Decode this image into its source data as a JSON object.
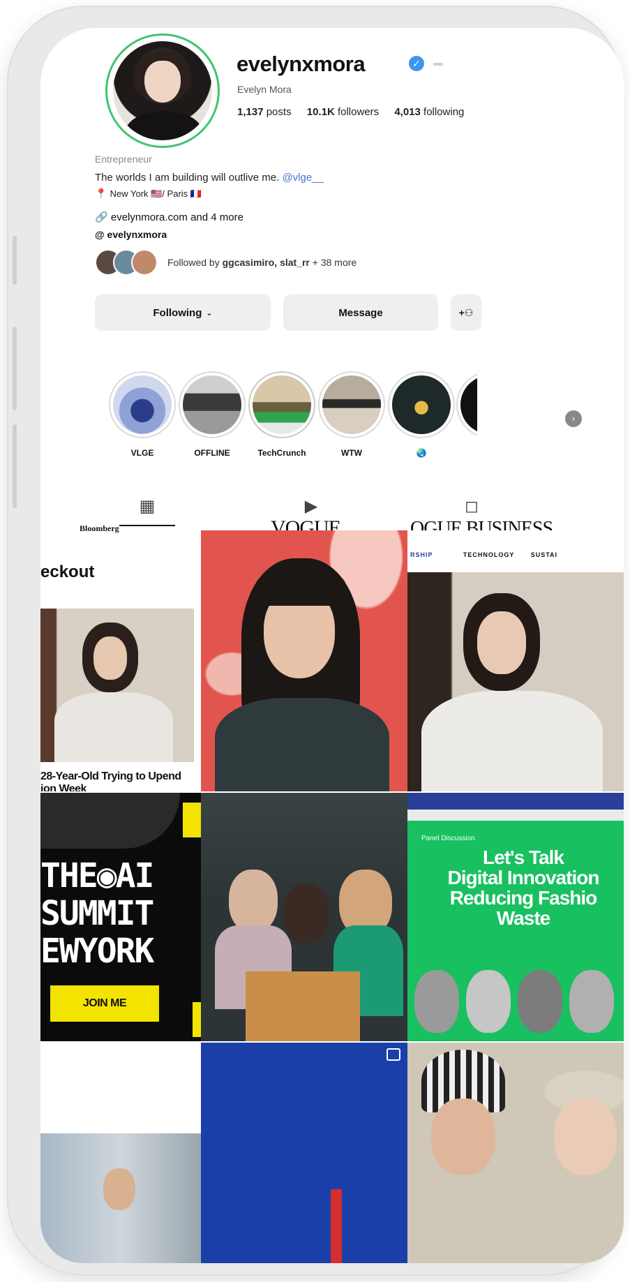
{
  "profile": {
    "username": "evelynxmora",
    "full_name": "Evelyn Mora",
    "stats": {
      "posts_value": "1,137",
      "posts_label": "posts",
      "followers_value": "10.1K",
      "followers_label": "followers",
      "following_value": "4,013",
      "following_label": "following"
    },
    "category": "Entrepreneur",
    "bio_text": "The worlds I am building will outlive me.",
    "bio_mention": "@vlge__",
    "location": "New York 🇺🇸/ Paris 🇫🇷",
    "link": "evelynmora.com and 4 more",
    "threads_handle": "evelynxmora",
    "followed_prefix": "Followed by",
    "followed_names": "ggcasimiro, slat_rr",
    "followed_suffix": "+ 38 more"
  },
  "buttons": {
    "following": "Following",
    "message": "Message"
  },
  "highlights": [
    {
      "label": "VLGE"
    },
    {
      "label": "OFFLINE"
    },
    {
      "label": "TechCrunch"
    },
    {
      "label": "WTW"
    },
    {
      "label": "🌏"
    }
  ],
  "posts": {
    "bloomberg": "Bloomberg",
    "checkout": "eckout",
    "headline_line1": "28-Year-Old Trying to Upend",
    "headline_line2": "ion Week",
    "vogue": "VOGUE",
    "vogue_business": "OGUE BUSINESS",
    "vb_nav_1": "RSHIP",
    "vb_nav_2": "TECHNOLOGY",
    "vb_nav_3": "SUSTAI",
    "ai_summit_1": "THE◉AI",
    "ai_summit_2": "SUMMIT",
    "ai_summit_3": "EWYORK",
    "join": "JOIN ME",
    "panel_title_1": "Let's Talk",
    "panel_title_2": "Digital Innovation",
    "panel_title_3": "Reducing Fashio",
    "panel_title_4": "Waste",
    "panel_small": "Panel Discussion"
  }
}
